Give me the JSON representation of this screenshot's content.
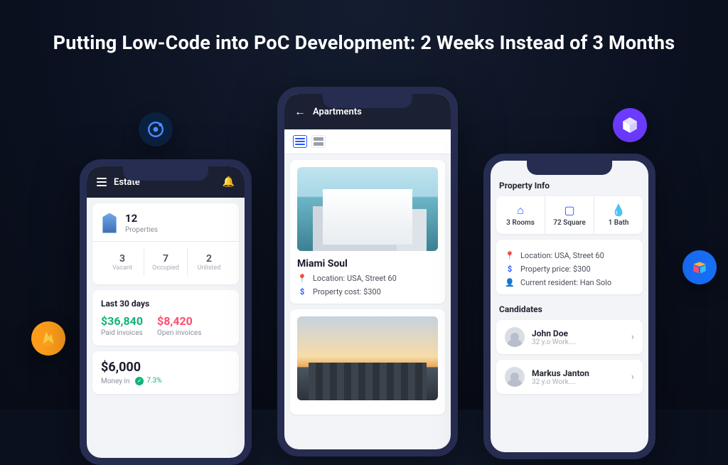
{
  "title": "Putting Low-Code into PoC Development: 2 Weeks Instead of 3 Months",
  "brands": {
    "ionic": "ionic-logo",
    "firebase": "firebase-logo",
    "webpack": "cube-logo",
    "airtable": "airtable-logo"
  },
  "left": {
    "app_title": "Estate",
    "properties": {
      "count": "12",
      "label": "Properties"
    },
    "status": {
      "vacant": {
        "n": "3",
        "l": "Vacant"
      },
      "occupied": {
        "n": "7",
        "l": "Occupied"
      },
      "unlisted": {
        "n": "2",
        "l": "Unlisted"
      }
    },
    "period_label": "Last 30 days",
    "paid": {
      "amount": "$36,840",
      "label": "Paid invoices"
    },
    "open": {
      "amount": "$8,420",
      "label": "Open invoices"
    },
    "money_in": {
      "amount": "$6,000",
      "label": "Money in",
      "delta": "7.3%"
    }
  },
  "center": {
    "title": "Apartments",
    "listing": {
      "name": "Miami Soul",
      "location_label": "Location: USA, Street 60",
      "cost_label": "Property cost: $300"
    }
  },
  "right": {
    "info_title": "Property Info",
    "features": {
      "rooms": "3 Rooms",
      "square": "72 Square",
      "bath": "1 Bath"
    },
    "details": {
      "location": "Location: USA, Street 60",
      "price": "Property price: $300",
      "resident": "Current resident: Han Solo"
    },
    "candidates_title": "Candidates",
    "candidates": [
      {
        "name": "John Doe",
        "sub": "32 y.o Work...."
      },
      {
        "name": "Markus Janton",
        "sub": "32 y.o Work...."
      }
    ]
  }
}
